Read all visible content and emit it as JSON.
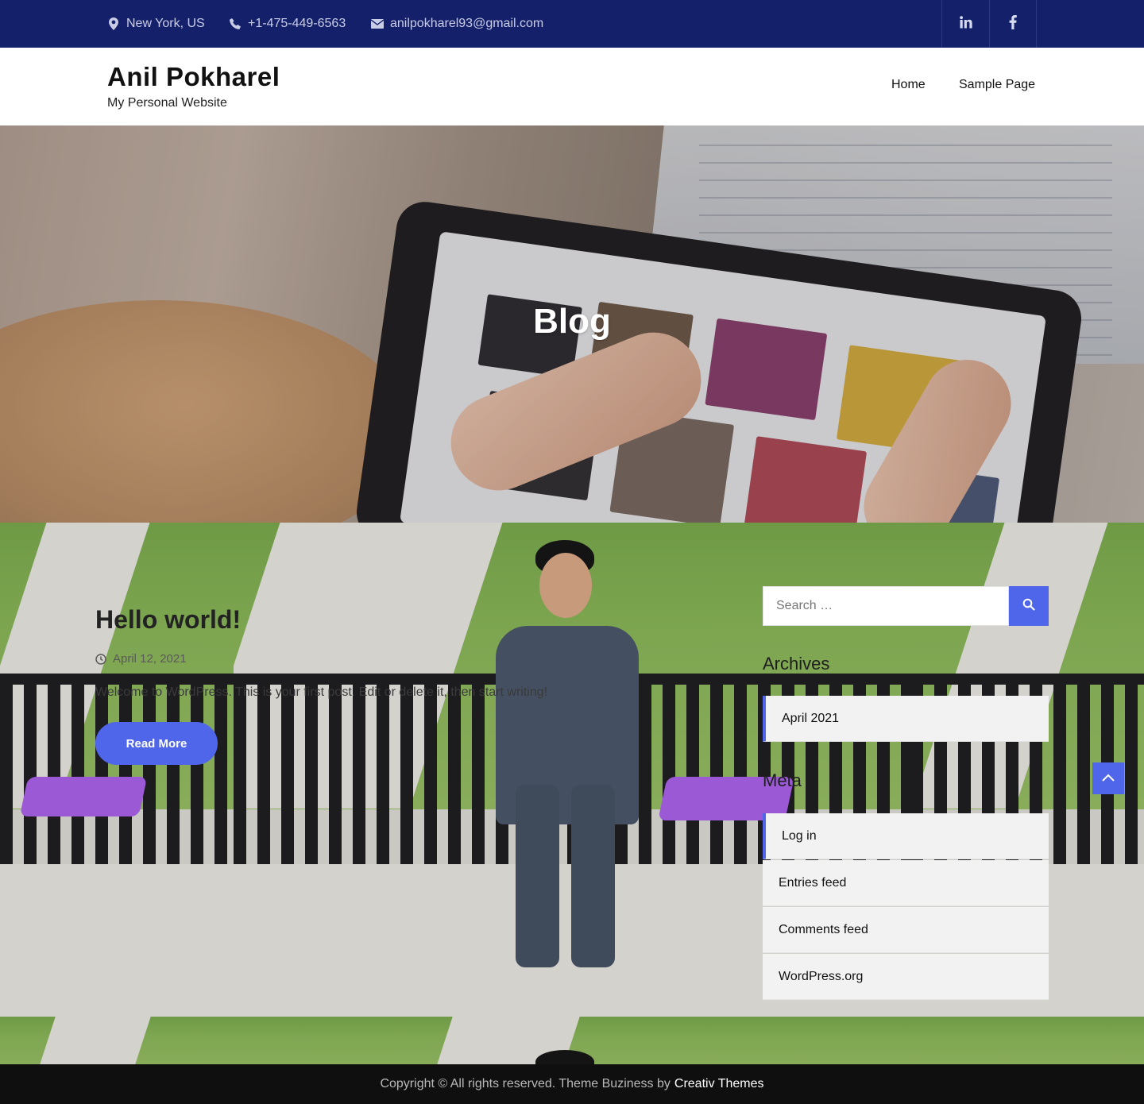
{
  "topbar": {
    "location": "New York, US",
    "phone": "+1-475-449-6563",
    "email": "anilpokharel93@gmail.com",
    "social": [
      "linkedin-icon",
      "facebook-icon"
    ]
  },
  "header": {
    "site_title": "Anil Pokharel",
    "tagline": "My Personal Website",
    "nav": [
      "Home",
      "Sample Page"
    ]
  },
  "banner": {
    "title": "Blog"
  },
  "post": {
    "title": "Hello world!",
    "date": "April 12, 2021",
    "excerpt": "Welcome to WordPress. This is your first post. Edit or delete it, then start writing!",
    "read_more": "Read More"
  },
  "sidebar": {
    "search_placeholder": "Search …",
    "archives_title": "Archives",
    "archives": [
      "April 2021"
    ],
    "meta_title": "Meta",
    "meta": [
      "Log in",
      "Entries feed",
      "Comments feed",
      "WordPress.org"
    ]
  },
  "footer": {
    "copyright": "Copyright © All rights reserved. Theme Buziness by",
    "credit": "Creativ Themes"
  },
  "colors": {
    "topbar": "#14206a",
    "accent": "#4f66ea",
    "footer": "#0f0f10"
  }
}
